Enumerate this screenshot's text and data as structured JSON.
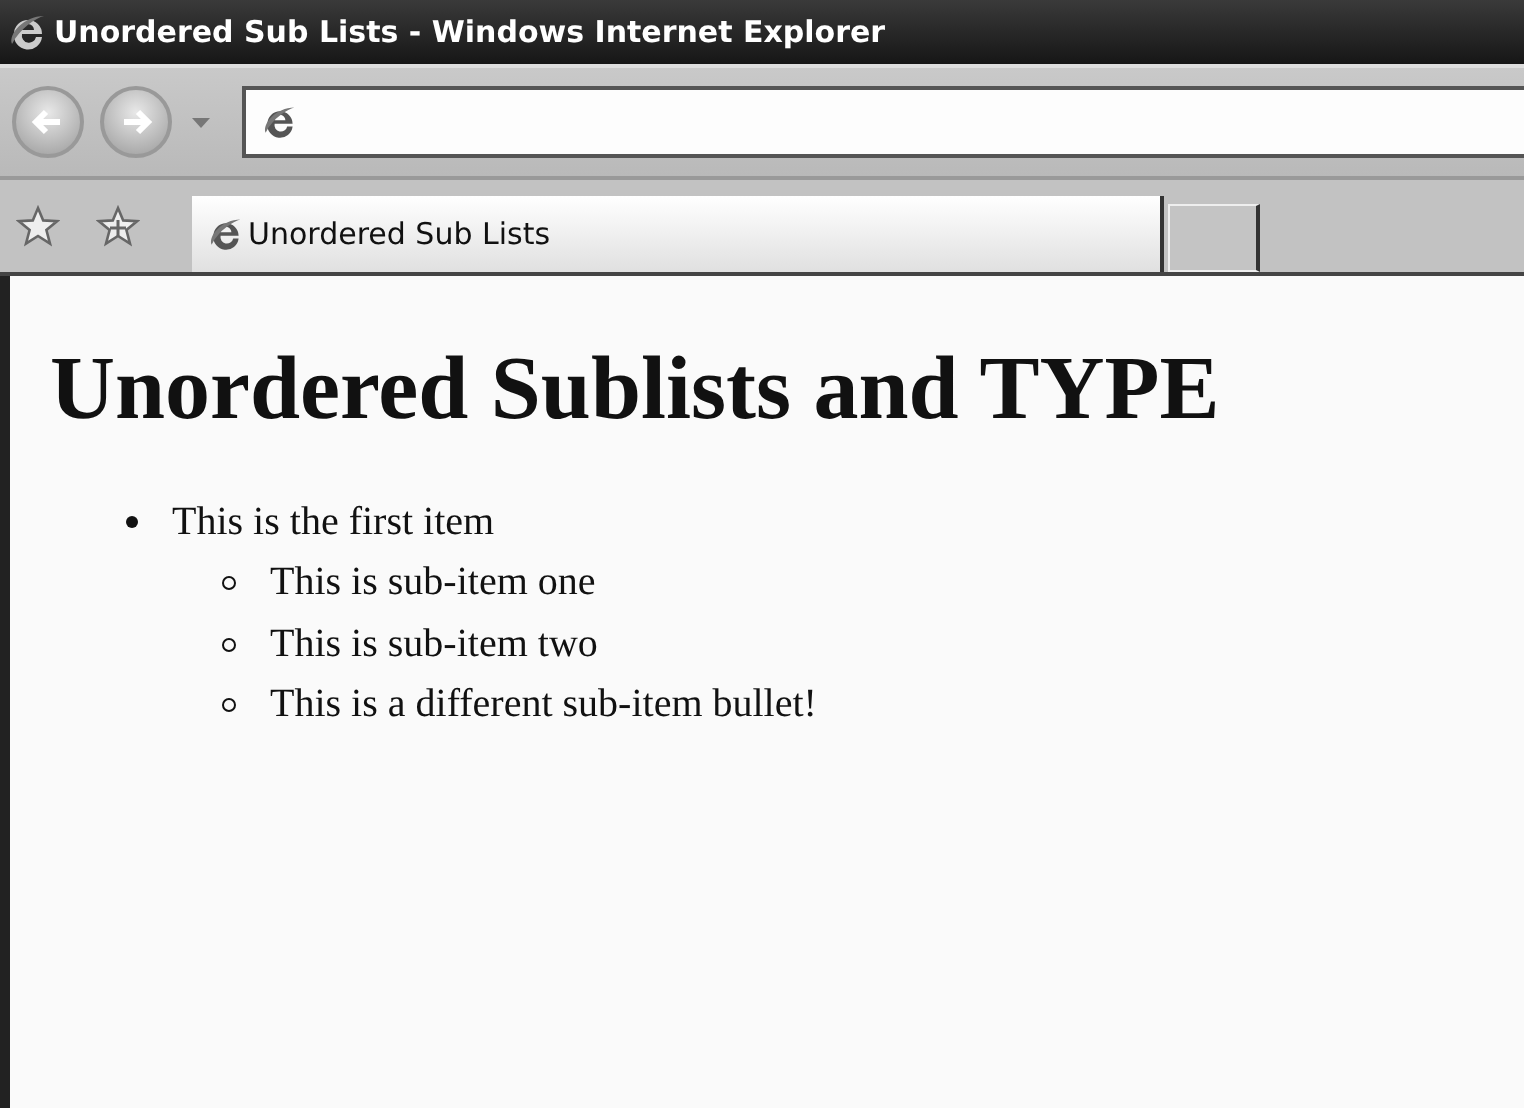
{
  "window": {
    "title": "Unordered Sub Lists - Windows Internet Explorer"
  },
  "tab": {
    "title": "Unordered Sub Lists",
    "selected": true
  },
  "page": {
    "heading": "Unordered Sublists and TYPE",
    "list": {
      "kind": "disc",
      "items": [
        {
          "text": "This is the first item",
          "children": {
            "kind": "circle",
            "items": [
              {
                "text": "This is sub-item one"
              },
              {
                "text": "This is sub-item two"
              },
              {
                "text": "This is a different sub-item bullet!"
              }
            ]
          }
        }
      ]
    }
  }
}
